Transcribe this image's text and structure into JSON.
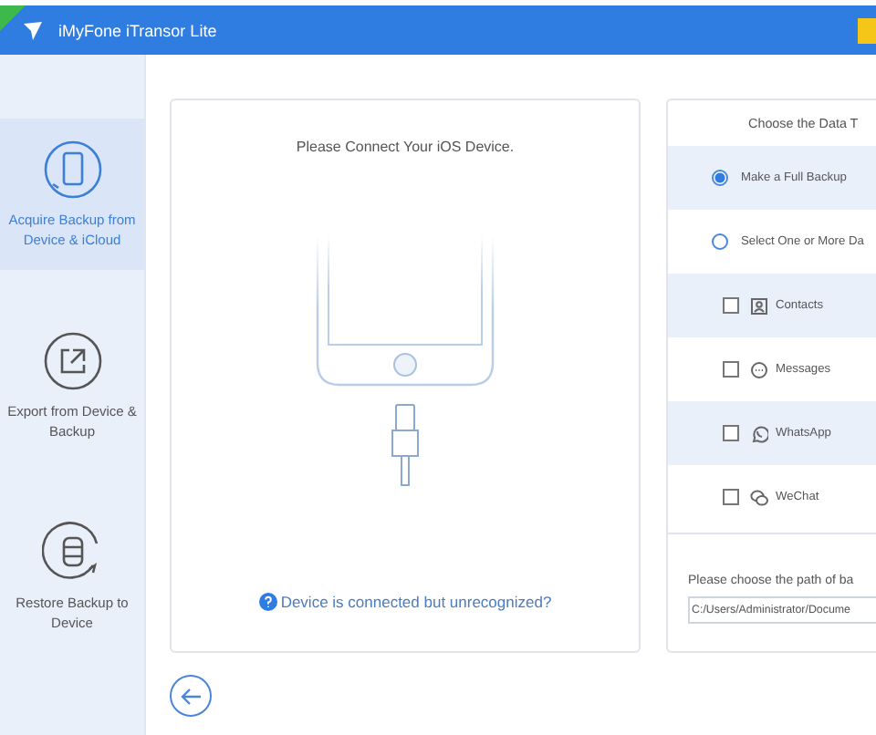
{
  "window": {
    "title": "iMyFone iTransor Lite"
  },
  "sidebar": {
    "items": [
      {
        "label": "Acquire Backup from Device & iCloud",
        "selected": true,
        "kind": "acquire"
      },
      {
        "label": "Export from Device & Backup",
        "selected": false,
        "kind": "export"
      },
      {
        "label": "Restore Backup to Device",
        "selected": false,
        "kind": "restore"
      }
    ]
  },
  "connect_panel": {
    "title": "Please Connect Your iOS Device.",
    "help_link": "Device is connected but unrecognized?"
  },
  "data_panel": {
    "title": "Choose the Data T",
    "options": [
      {
        "kind": "radio",
        "label": "Make a Full Backup",
        "selected": true
      },
      {
        "kind": "radio",
        "label": "Select One or More Da",
        "selected": false
      },
      {
        "kind": "checkbox",
        "label": "Contacts",
        "checked": false
      },
      {
        "kind": "checkbox",
        "label": "Messages",
        "checked": false
      },
      {
        "kind": "checkbox",
        "label": "WhatsApp",
        "checked": false
      },
      {
        "kind": "checkbox",
        "label": "WeChat",
        "checked": false
      }
    ],
    "path_label": "Please choose the path of ba",
    "path_value": "C:/Users/Administrator/Docume"
  }
}
